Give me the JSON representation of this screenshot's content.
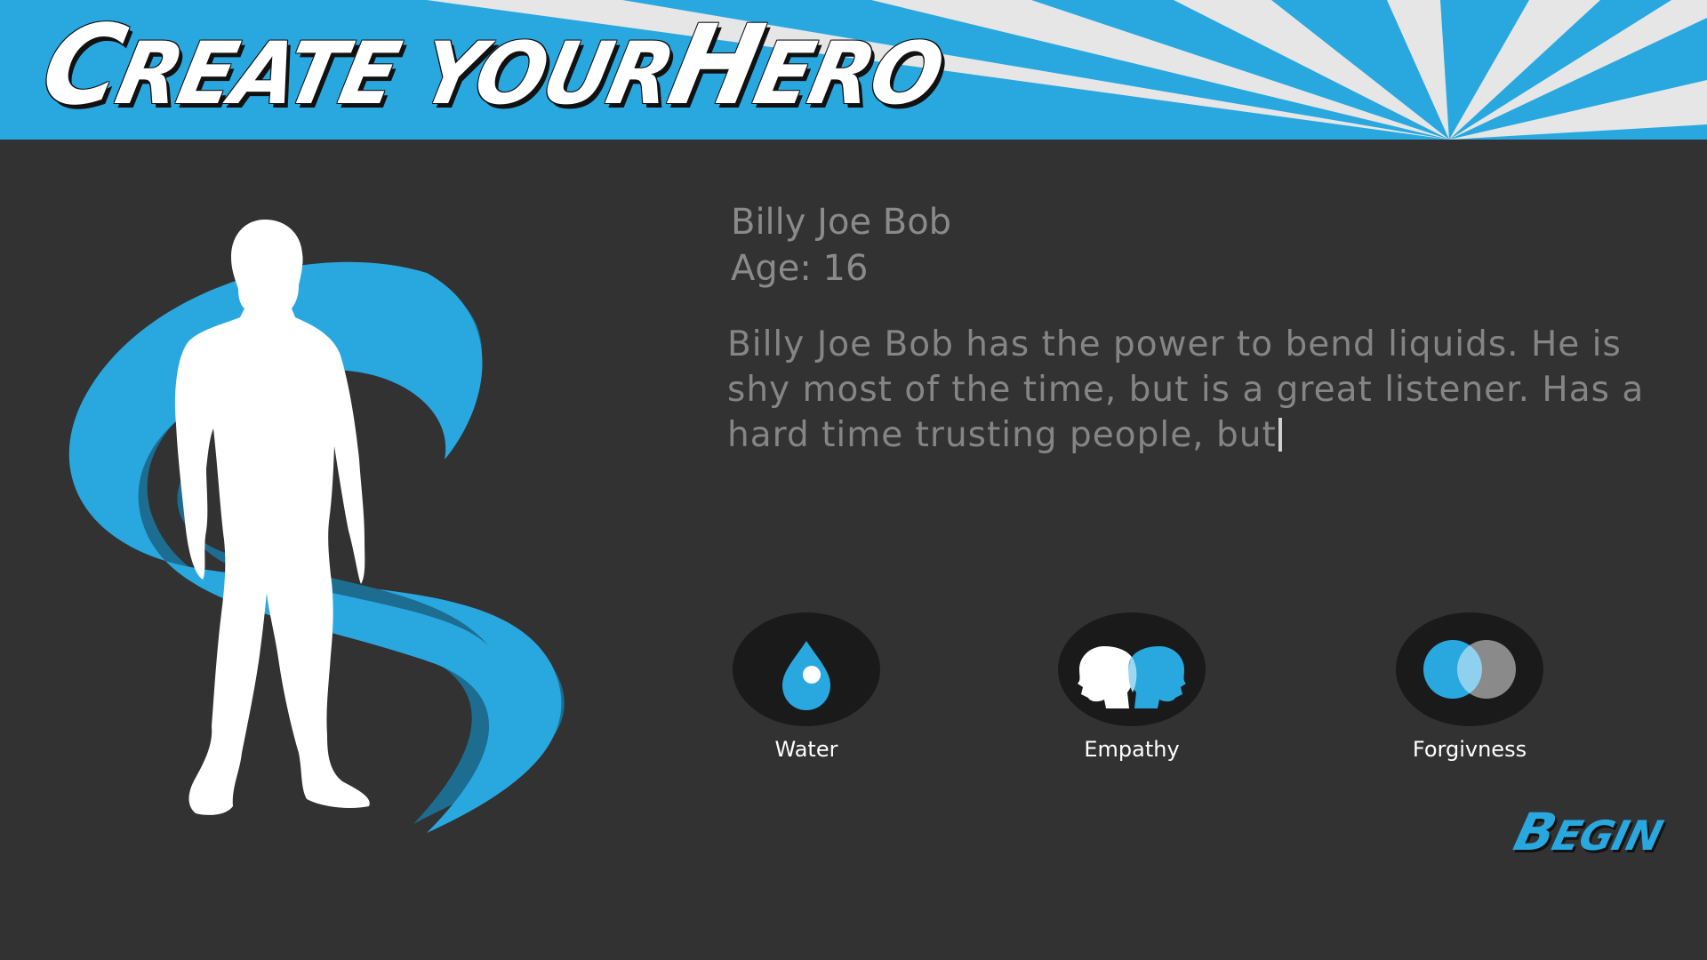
{
  "header": {
    "title_cap_1": "C",
    "title_part_1": "REATE ",
    "title_part_2": "YOUR",
    "title_cap_2": "H",
    "title_part_3": "ERO",
    "background_color": "#29a8e0",
    "ray_color": "#e6e6e6"
  },
  "hero": {
    "name": "Billy Joe Bob",
    "age": "Age: 16",
    "bio": "Billy Joe Bob has the power to bend liquids. He is shy most of the time, but is a great listener. Has a hard time trusting people, but"
  },
  "powers": [
    {
      "label": "Water",
      "icon": "water-drop-icon"
    },
    {
      "label": "Empathy",
      "icon": "empathy-heads-icon"
    },
    {
      "label": "Forgivness",
      "icon": "overlapping-circles-icon"
    }
  ],
  "actions": {
    "begin_cap": "B",
    "begin_rest": "EGIN"
  },
  "colors": {
    "accent": "#29a8e0",
    "background": "#323232",
    "text_muted": "#858585"
  }
}
